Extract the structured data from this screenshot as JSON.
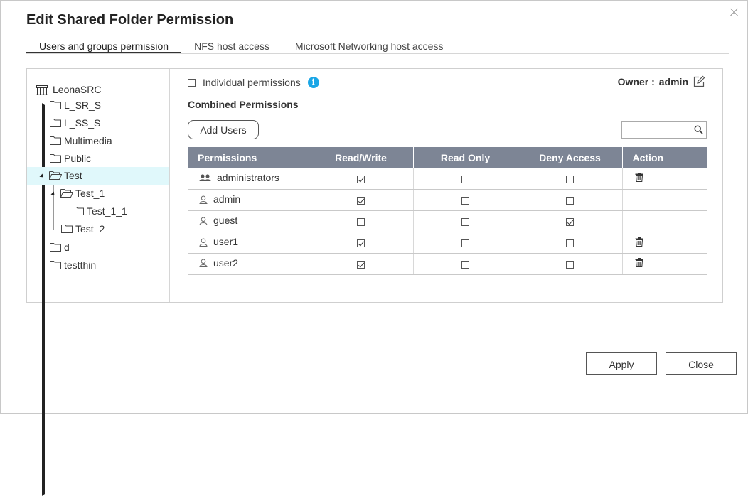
{
  "dialog": {
    "title": "Edit Shared Folder Permission"
  },
  "tabs": [
    {
      "label": "Users and groups permission",
      "active": true
    },
    {
      "label": "NFS host access",
      "active": false
    },
    {
      "label": "Microsoft Networking host access",
      "active": false
    }
  ],
  "tree": {
    "root": "LeonaSRC",
    "items": [
      {
        "label": "L_SR_S"
      },
      {
        "label": "L_SS_S"
      },
      {
        "label": "Multimedia"
      },
      {
        "label": "Public"
      },
      {
        "label": "Test",
        "selected": true,
        "expanded": true
      },
      {
        "label": "Test_1",
        "expanded": true
      },
      {
        "label": "Test_1_1"
      },
      {
        "label": "Test_2"
      },
      {
        "label": "d"
      },
      {
        "label": "testthin"
      }
    ]
  },
  "permissions": {
    "individual_label": "Individual permissions",
    "individual_checked": false,
    "owner_label": "Owner :",
    "owner_value": "admin",
    "combined_title": "Combined Permissions",
    "add_users_label": "Add Users",
    "search_placeholder": "",
    "columns": [
      "Permissions",
      "Read/Write",
      "Read Only",
      "Deny Access",
      "Action"
    ],
    "rows": [
      {
        "name": "administrators",
        "icon": "group-icon",
        "read_write": true,
        "read_only": false,
        "deny": false,
        "deletable": true
      },
      {
        "name": "admin",
        "icon": "user-icon",
        "read_write": true,
        "read_only": false,
        "deny": false,
        "deletable": false
      },
      {
        "name": "guest",
        "icon": "user-icon",
        "read_write": false,
        "read_only": false,
        "deny": true,
        "deletable": false
      },
      {
        "name": "user1",
        "icon": "user-icon",
        "read_write": true,
        "read_only": false,
        "deny": false,
        "deletable": true
      },
      {
        "name": "user2",
        "icon": "user-icon",
        "read_write": true,
        "read_only": false,
        "deny": false,
        "deletable": true
      }
    ]
  },
  "footer": {
    "apply_label": "Apply",
    "close_label": "Close"
  },
  "colors": {
    "header_bg": "#7d8595",
    "selected_row": "#e0f8fb",
    "info_accent": "#1aa6e6"
  }
}
